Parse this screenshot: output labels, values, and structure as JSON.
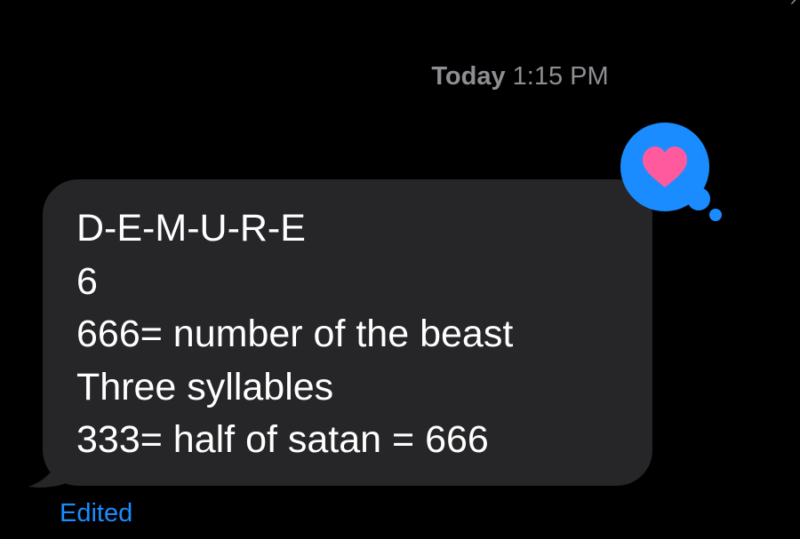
{
  "header": {
    "timestamp_day": "Today",
    "timestamp_time": "1:15 PM"
  },
  "message": {
    "lines": [
      "D-E-M-U-R-E",
      "6",
      "666= number of the beast",
      "Three syllables",
      "333= half of satan = 666"
    ],
    "bubble_color": "#262628",
    "status": "Edited"
  },
  "reaction": {
    "icon": "heart-icon",
    "badge_color": "#1a8cff",
    "heart_color": "#ff5a9e"
  },
  "colors": {
    "background": "#000000",
    "timestamp": "#8e8e93",
    "accent": "#1a8cff"
  }
}
